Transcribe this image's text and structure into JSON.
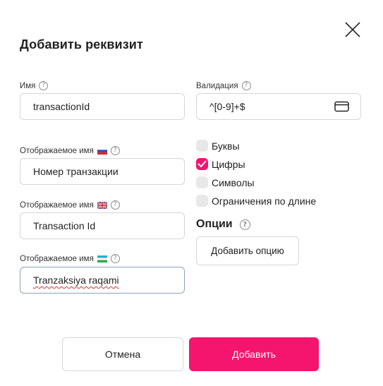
{
  "dialog": {
    "title": "Добавить реквизит",
    "close_icon": "close-icon"
  },
  "fields": {
    "name": {
      "label": "Имя",
      "value": "transactionId"
    },
    "display_ru": {
      "label": "Отображаемое имя",
      "flag": "ru-flag",
      "value": "Номер транзакции"
    },
    "display_en": {
      "label": "Отображаемое имя",
      "flag": "gb-flag",
      "value": "Transaction Id"
    },
    "display_uz": {
      "label": "Отображаемое имя",
      "flag": "uz-flag",
      "value": "Tranzaksiya raqami"
    },
    "validation": {
      "label": "Валидация",
      "value": "^[0-9]+$"
    }
  },
  "validation_options": [
    {
      "label": "Буквы",
      "checked": false
    },
    {
      "label": "Цифры",
      "checked": true
    },
    {
      "label": "Символы",
      "checked": false
    },
    {
      "label": "Ограничения по длине",
      "checked": false
    }
  ],
  "options": {
    "title": "Опции",
    "add_button": "Добавить опцию"
  },
  "footer": {
    "cancel": "Отмена",
    "submit": "Добавить"
  },
  "colors": {
    "accent": "#f5146e",
    "border": "#d6d6d6",
    "checkbox_off": "#e8e8e8"
  }
}
